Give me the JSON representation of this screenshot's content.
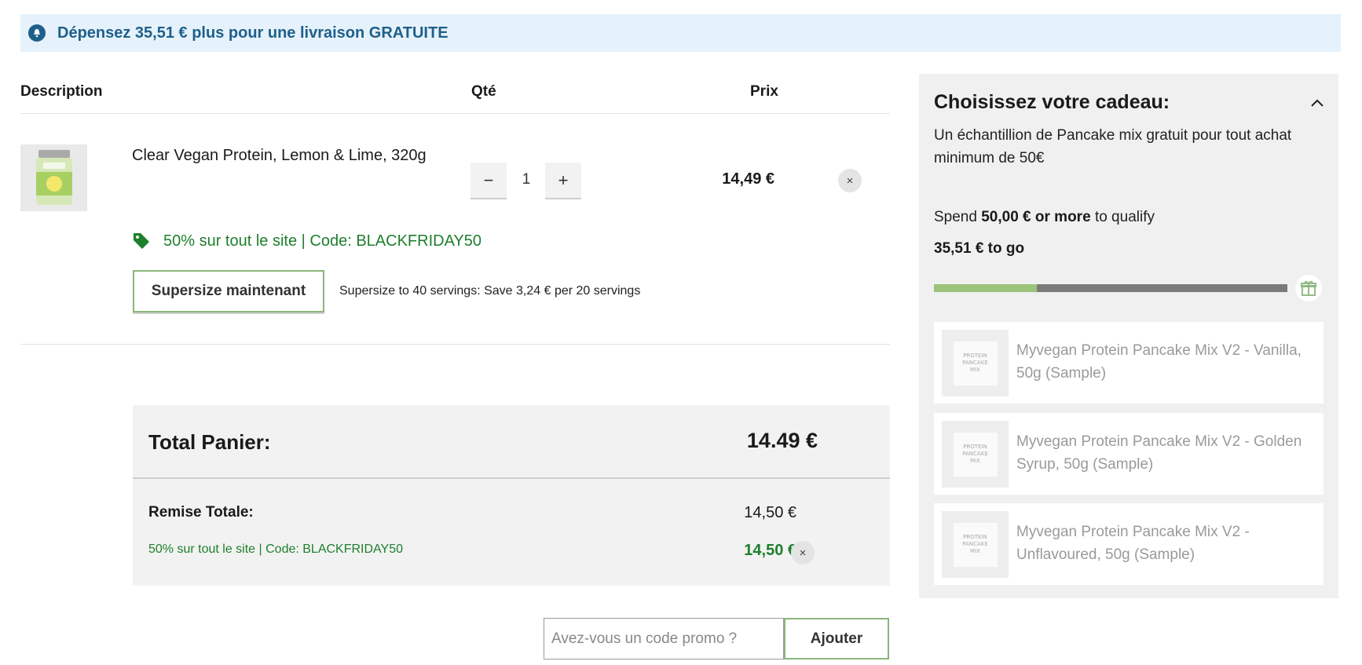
{
  "banner": {
    "text": "Dépensez 35,51 € plus pour une livraison GRATUITE",
    "icon": "info-icon"
  },
  "table": {
    "headers": {
      "description": "Description",
      "qty": "Qté",
      "price": "Prix"
    }
  },
  "cart_item": {
    "name": "Clear Vegan Protein, Lemon & Lime, 320g",
    "quantity": "1",
    "decrement_label": "−",
    "increment_label": "+",
    "price": "14,49 €",
    "remove_label": "×",
    "promo": "50% sur tout le site | Code: BLACKFRIDAY50",
    "supersize_button": "Supersize maintenant",
    "supersize_note": "Supersize to 40 servings: Save 3,24 € per 20 servings"
  },
  "totals": {
    "total_label": "Total Panier:",
    "total_value": "14.49 €",
    "remise_label": "Remise Totale:",
    "remise_value": "14,50 €",
    "discount_label": "50% sur tout le site | Code: BLACKFRIDAY50",
    "discount_value": "14,50 €",
    "remove_label": "×"
  },
  "coupon": {
    "placeholder": "Avez-vous un code promo ?",
    "button": "Ajouter"
  },
  "gift_panel": {
    "title": "Choisissez votre cadeau:",
    "description": "Un échantillion de Pancake mix gratuit pour tout achat minimum de 50€",
    "spend_prefix": "Spend",
    "spend_amount": "50,00 € or more",
    "spend_suffix": "to qualify",
    "to_go": "35,51 € to go",
    "progress_fraction": 0.29,
    "items": [
      {
        "name": "Myvegan Protein Pancake Mix V2 - Vanilla, 50g (Sample)"
      },
      {
        "name": "Myvegan Protein Pancake Mix V2 - Golden Syrup, 50g (Sample)"
      },
      {
        "name": "Myvegan Protein Pancake Mix V2 - Unflavoured, 50g (Sample)"
      }
    ],
    "thumb_lines": [
      "PROTEIN",
      "PANCAKE",
      "MIX"
    ]
  },
  "colors": {
    "banner_bg": "#e6f2fb",
    "banner_text": "#1f5f8b",
    "promo_green": "#1e7f2c",
    "button_border": "#8bb57c",
    "progress_fill": "#9cc37a",
    "progress_track": "#7a7a7a"
  }
}
